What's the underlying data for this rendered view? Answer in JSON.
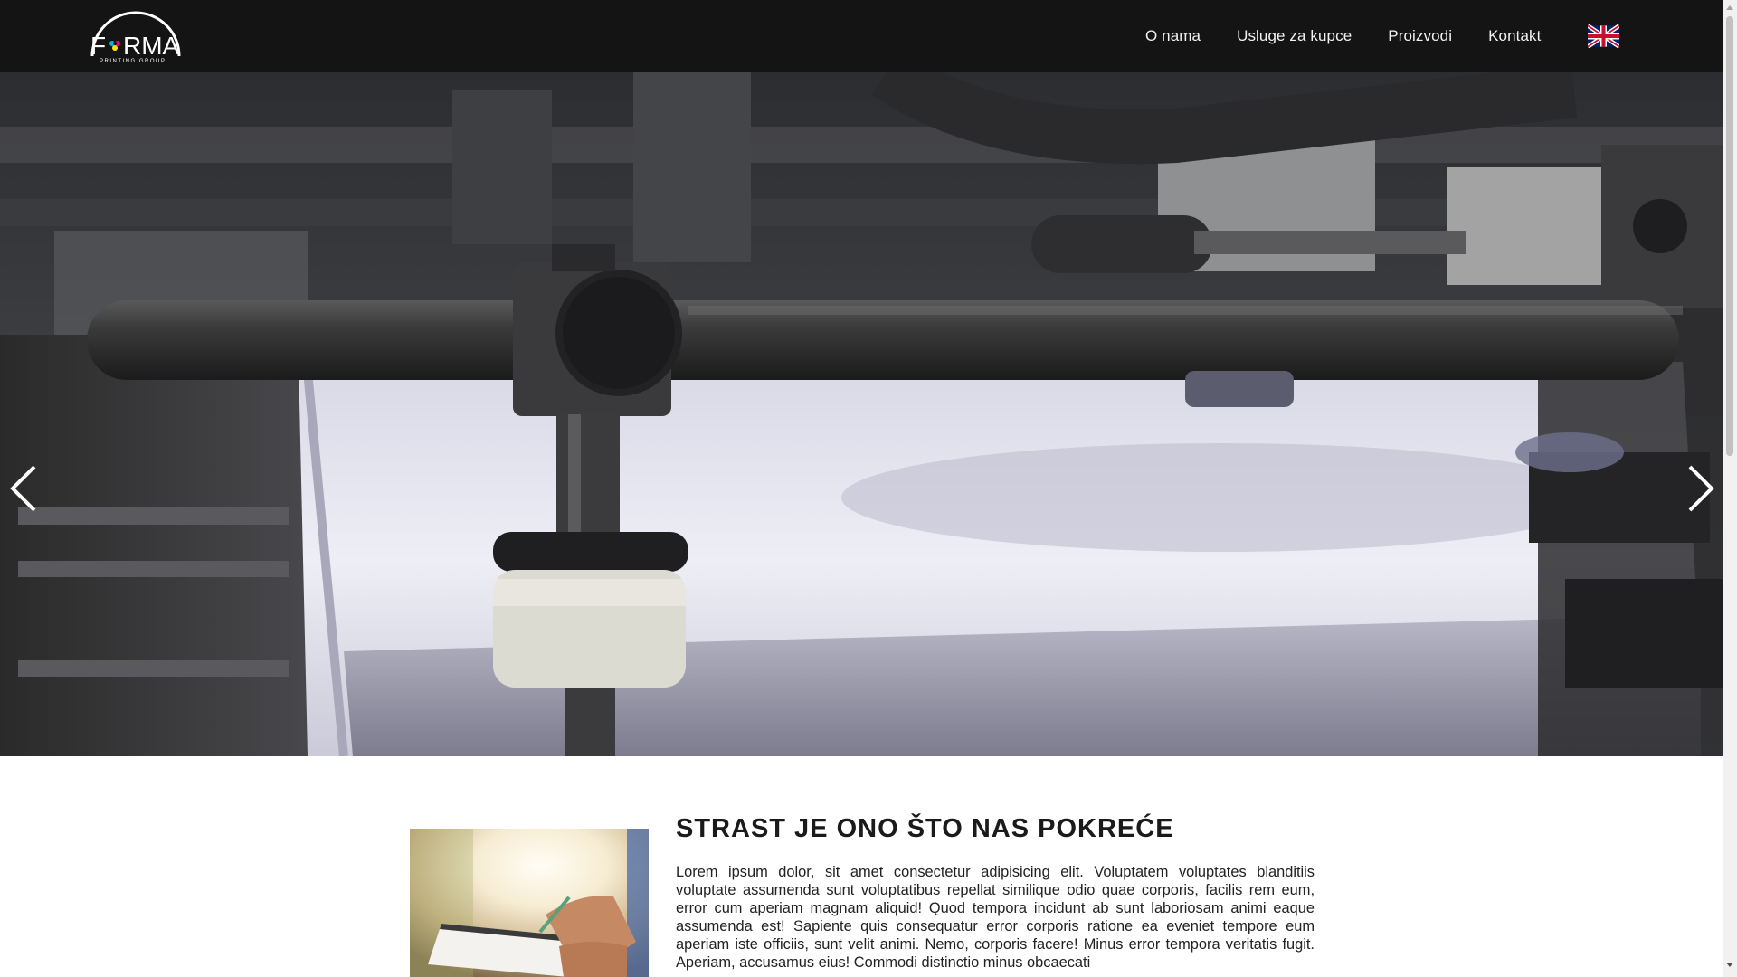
{
  "brand": {
    "logo_text": "FORMA",
    "logo_subtext": "PRINTING GROUP"
  },
  "nav": {
    "items": [
      {
        "label": "O nama"
      },
      {
        "label": "Usluge za kupce"
      },
      {
        "label": "Proizvodi"
      },
      {
        "label": "Kontakt"
      }
    ],
    "language_icon": "uk-flag-icon"
  },
  "hero": {
    "image": "printing-press-machine-with-paper-stack",
    "prev_icon": "chevron-left-icon",
    "next_icon": "chevron-right-icon"
  },
  "about": {
    "title": "STRAST JE ONO ŠTO NAS POKREĆE",
    "image": "hand-writing-on-clipboard",
    "text": "Lorem ipsum dolor, sit amet consectetur adipisicing elit. Voluptatem voluptates blanditiis voluptate assumenda sunt voluptatibus repellat similique odio quae corporis, facilis rem eum, error cum aperiam magnam aliquid! Quod tempora incidunt ab sunt laboriosam animi eaque assumenda est! Sapiente quis consequatur error corporis ratione ea eveniet tempore eum aperiam iste officiis, sunt velit animi. Nemo, corporis facere! Minus error tempora veritatis fugit. Aperiam, accusamus eius! Commodi distinctio minus obcaecati"
  },
  "colors": {
    "navbar_bg": "#141414",
    "nav_text": "#f2f2f2",
    "page_bg": "#ffffff",
    "title_text": "#1a1a1a"
  }
}
